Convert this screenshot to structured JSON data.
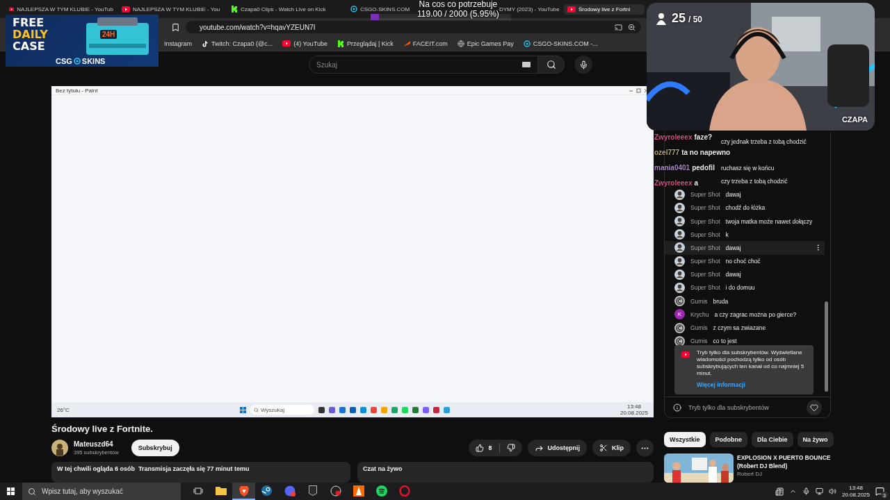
{
  "browser": {
    "tabs": [
      {
        "title": "NAJLEPSZA W TYM KLUBIE - YouTub",
        "kind": "youtube",
        "selected": false
      },
      {
        "title": "NAJLEPSZA W TYM KLUBIE - You",
        "kind": "youtube",
        "selected": false
      },
      {
        "title": "Czapa0 Clips - Watch Live on Kick",
        "kind": "kick",
        "selected": false
      },
      {
        "title": "CSGO-SKINS.COM",
        "kind": "csgo",
        "selected": false
      },
      {
        "title": "DYMY (2023) - YouTube",
        "kind": "plain",
        "selected": false
      },
      {
        "title": "Środowy live z Fortni",
        "kind": "youtube",
        "selected": true
      }
    ],
    "url": "youtube.com/watch?v=hqavYZEUN7I",
    "bookmarks": [
      {
        "label": "Instagram",
        "kind": "plain"
      },
      {
        "label": "Twitch: Czapa0 (@c...",
        "kind": "tiktok"
      },
      {
        "label": "(4) YouTube",
        "kind": "youtube"
      },
      {
        "label": "Przeglądaj | Kick",
        "kind": "kick"
      },
      {
        "label": "FACEIT.com",
        "kind": "faceit"
      },
      {
        "label": "Epic Games Pay",
        "kind": "globe"
      },
      {
        "label": "CSGO-SKINS.COM -...",
        "kind": "csgo"
      }
    ]
  },
  "youtube": {
    "search": {
      "placeholder": "Szukaj"
    }
  },
  "video": {
    "window_title": "Bez tytułu - Paint",
    "weather": "26°C",
    "search_placeholder": "Wyszukaj",
    "time": "13:48",
    "date": "20.08.2025"
  },
  "video_info": {
    "title": "Środowy live z Fortnite.",
    "channel": "Mateuszd64",
    "subscribers": "395 subskrybentów",
    "subscribe": "Subskrybuj",
    "likes": "8",
    "share": "Udostępnij",
    "clip": "Klip",
    "viewers": "W tej chwili ogląda 6 osób",
    "started": "Transmisja zaczęła się 77 minut temu",
    "chat_toggle": "Czat na żywo"
  },
  "chat": {
    "messages": [
      {
        "text": "czy jednak trzeba z tobą chodzić",
        "kind": "covered",
        "hovered": false
      },
      {
        "text": "ruchasz się w końcu",
        "kind": "covered",
        "hovered": false
      },
      {
        "text": "czy trzeba z tobą chodzić",
        "kind": "covered",
        "hovered": false
      },
      {
        "author": "Super Shot",
        "text": "dawaj",
        "hovered": false
      },
      {
        "author": "Super Shot",
        "text": "chodź do łóżka",
        "hovered": false
      },
      {
        "author": "Super Shot",
        "text": "twoja matka może nawet dołączy",
        "hovered": false
      },
      {
        "author": "Super Shot",
        "text": "k",
        "hovered": false
      },
      {
        "author": "Super Shot",
        "text": "dawaj",
        "hovered": true
      },
      {
        "author": "Super Shot",
        "text": "no choć choć",
        "hovered": false
      },
      {
        "author": "Super Shot",
        "text": "dawaj",
        "hovered": false
      },
      {
        "author": "Super Shot",
        "text": "i do domuu",
        "hovered": false
      },
      {
        "author": "Gumis",
        "text": "bruda",
        "kind": "logo",
        "hovered": false
      },
      {
        "author": "Krychu",
        "text": "a czy zagrac można po gierce?",
        "kind": "letter",
        "letter": "K",
        "hovered": false
      },
      {
        "author": "Gumis",
        "text": "z czym sa zwiazane",
        "kind": "logo",
        "hovered": false
      },
      {
        "author": "Gumis",
        "text": "co to jest",
        "kind": "logo",
        "hovered": false
      }
    ],
    "notice": {
      "text": "Tryb tylko dla subskrybentów. Wyświetlane wiadomości pochodzą tylko od osób subskrybujących ten kanał od co najmniej 5 minut.",
      "link": "Więcej informacji"
    },
    "footer": "Tryb tylko dla subskrybentów"
  },
  "chips": [
    {
      "label": "Wszystkie",
      "selected": true
    },
    {
      "label": "Podobne",
      "selected": false
    },
    {
      "label": "Dla Ciebie",
      "selected": false
    },
    {
      "label": "Na żywo",
      "selected": false
    }
  ],
  "recommended": {
    "kind": "picture",
    "title": "EXPLOSION X PUERTO BOUNCE (Robert DJ Blend)",
    "channel": "Robert DJ"
  },
  "overlay": {
    "ad": {
      "lines": [
        "FREE",
        "DAILY",
        "CASE"
      ],
      "badge": "24H",
      "brand_left": "CSG",
      "brand_right": "SKINS"
    },
    "goal": {
      "title": "Na cos co potrzebuje",
      "progress": "119.00 / 2000 (5.95%)",
      "level": 0.0595
    },
    "webcam": {
      "count": "25",
      "total": "/ 50",
      "name": "CZAPA"
    },
    "stream_chat": [
      {
        "user": "Zwyroleeex",
        "color": "#d94f8a",
        "text": "faze?"
      },
      {
        "user": "ozel777",
        "color": "#b9ad6e",
        "text": "ta no napewno"
      },
      {
        "user": "mania0401",
        "color": "#a98bc9",
        "text": "pedofil"
      },
      {
        "user": "Zwyroleeex",
        "color": "#d94f8a",
        "text": "a"
      }
    ]
  },
  "taskbar": {
    "search_placeholder": "Wpisz tutaj, aby wyszukać",
    "apps": [
      {
        "kind": "taskview",
        "active": false
      },
      {
        "kind": "files",
        "active": false
      },
      {
        "kind": "brave",
        "active": true
      },
      {
        "kind": "steam",
        "active": false
      },
      {
        "kind": "discord",
        "active": false
      },
      {
        "kind": "epic",
        "active": false
      },
      {
        "kind": "obs",
        "active": false
      },
      {
        "kind": "faceit",
        "active": false
      },
      {
        "kind": "spotify",
        "active": false
      },
      {
        "kind": "opera",
        "active": false
      }
    ],
    "time": "13:48",
    "date": "20.08.2025",
    "notifications": "3"
  }
}
